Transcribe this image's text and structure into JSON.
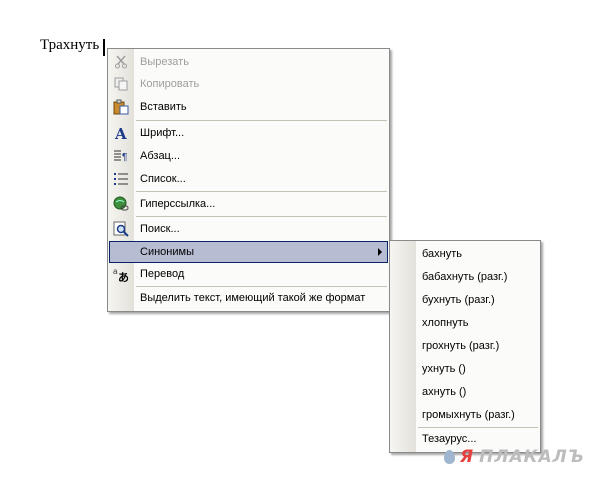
{
  "document": {
    "word": "Трахнуть"
  },
  "context_menu": {
    "items": [
      {
        "label": "Вырезать",
        "icon": "cut-icon",
        "disabled": true
      },
      {
        "label": "Копировать",
        "icon": "copy-icon",
        "disabled": true
      },
      {
        "label": "Вставить",
        "icon": "paste-icon",
        "disabled": false
      },
      {
        "label": "Шрифт...",
        "icon": "font-icon",
        "disabled": false
      },
      {
        "label": "Абзац...",
        "icon": "paragraph-icon",
        "disabled": false
      },
      {
        "label": "Список...",
        "icon": "list-icon",
        "disabled": false
      },
      {
        "label": "Гиперссылка...",
        "icon": "hyperlink-icon",
        "disabled": false
      },
      {
        "label": "Поиск...",
        "icon": "search-icon",
        "disabled": false
      },
      {
        "label": "Синонимы",
        "icon": "",
        "disabled": false,
        "highlighted": true,
        "submenu": true
      },
      {
        "label": "Перевод",
        "icon": "translate-icon",
        "disabled": false
      },
      {
        "label": "Выделить текст, имеющий такой же формат",
        "icon": "",
        "disabled": false
      }
    ]
  },
  "synonyms_submenu": {
    "items": [
      "бахнуть",
      "бабахнуть (разг.)",
      "бухнуть (разг.)",
      "хлопнуть",
      "грохнуть (разг.)",
      "ухнуть ()",
      "ахнуть ()",
      "громыхнуть (разг.)"
    ],
    "thesaurus_label": "Тезаурус..."
  },
  "watermark": {
    "drop_icon": "drop-icon",
    "word1": "Я",
    "word2": "ПЛАКАЛЪ"
  },
  "colors": {
    "highlight": "#b6bdd2",
    "highlight_border": "#0a246a",
    "watermark_red": "#e63f3f"
  }
}
